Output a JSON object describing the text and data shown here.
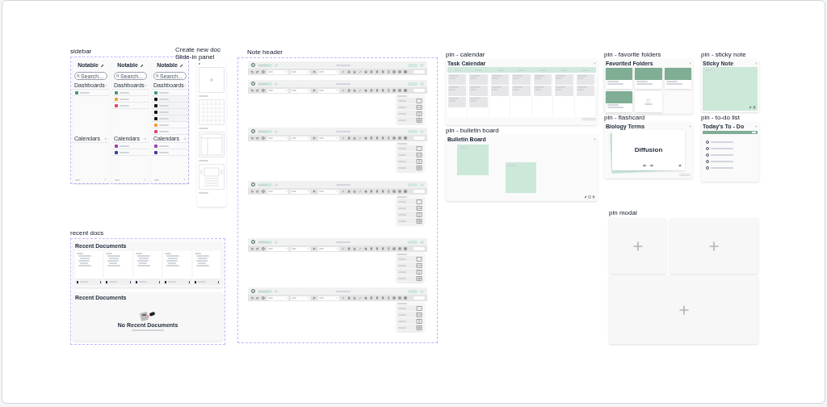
{
  "sidebar": {
    "title": "sidebar",
    "panels": [
      {
        "logo": "Notable",
        "search": "Search...",
        "dashboards": {
          "label": "Dashboards",
          "items": [
            {
              "color": "#3f9b74"
            }
          ]
        },
        "calendars": {
          "label": "Calendars"
        }
      },
      {
        "logo": "Notable",
        "search": "Search...",
        "dashboards": {
          "label": "Dashboards",
          "items": [
            {
              "color": "#3f9b74"
            },
            {
              "color": "#f0a030"
            },
            {
              "color": "#e0456a"
            }
          ]
        },
        "calendars": {
          "label": "Calendars",
          "items": [
            {
              "color": "#a040a0"
            },
            {
              "color": "#3b3b9b"
            }
          ]
        }
      },
      {
        "logo": "Notable",
        "search": "Search...",
        "dashboards": {
          "label": "Dashboards",
          "items": [
            {
              "color": "#3f9b74",
              "children": [
                {
                  "color": "#111111"
                },
                {
                  "color": "#111111"
                },
                {
                  "color": "#111111"
                },
                {
                  "color": "#111111"
                }
              ]
            },
            {
              "color": "#f0a030"
            },
            {
              "color": "#e0456a"
            }
          ]
        },
        "calendars": {
          "label": "Calendars",
          "items": [
            {
              "color": "#a040a0"
            },
            {
              "color": "#3b3b9b"
            }
          ]
        }
      }
    ]
  },
  "create_doc": {
    "title": "Create new doc Slide-in panel",
    "templates": [
      {
        "kind": "blank"
      },
      {
        "kind": "grid"
      },
      {
        "kind": "cornell"
      },
      {
        "kind": "slides"
      }
    ]
  },
  "note_header": {
    "title": "Note header",
    "instances": [
      {
        "dropdown_open": false
      },
      {
        "dropdown_open": true
      },
      {
        "dropdown_open": true
      },
      {
        "dropdown_open": true
      },
      {
        "dropdown_open": true
      },
      {
        "dropdown_open": true
      }
    ],
    "layout_options": [
      {
        "kind": "single"
      },
      {
        "kind": "rows"
      },
      {
        "kind": "columns"
      },
      {
        "kind": "grid"
      }
    ]
  },
  "recent_docs": {
    "title": "recent docs",
    "panels": [
      {
        "heading": "Recent Documents",
        "docs": [
          {
            "kind": "doc"
          },
          {
            "kind": "doc"
          },
          {
            "kind": "doc"
          },
          {
            "kind": "doc"
          },
          {
            "kind": "doc"
          }
        ]
      },
      {
        "heading": "Recent Documents",
        "empty_title": "No Recent Documents"
      }
    ]
  },
  "calendar": {
    "title": "pin - calendar",
    "heading": "Task Calendar"
  },
  "bulletin": {
    "title": "pin - bulletin board",
    "heading": "Bulletin Board"
  },
  "folders": {
    "title": "pin - favorite folders",
    "heading": "Favorited Folders",
    "folders": [
      {
        "kind": "folder"
      },
      {
        "kind": "folder"
      },
      {
        "kind": "folder"
      },
      {
        "kind": "folder"
      }
    ]
  },
  "flashcard": {
    "title": "pin - flashcard",
    "heading": "Biology Terms",
    "term": "Diffusion"
  },
  "sticky": {
    "title": "pin - sticky note",
    "heading": "Sticky Note"
  },
  "todo": {
    "title": "pin - to-do list",
    "heading": "Today's To - Do",
    "tasks": [
      {
        "checked": false
      },
      {
        "checked": false
      },
      {
        "checked": false
      },
      {
        "checked": false
      },
      {
        "checked": false
      }
    ]
  },
  "pin_modal": {
    "title": "pin modal"
  }
}
